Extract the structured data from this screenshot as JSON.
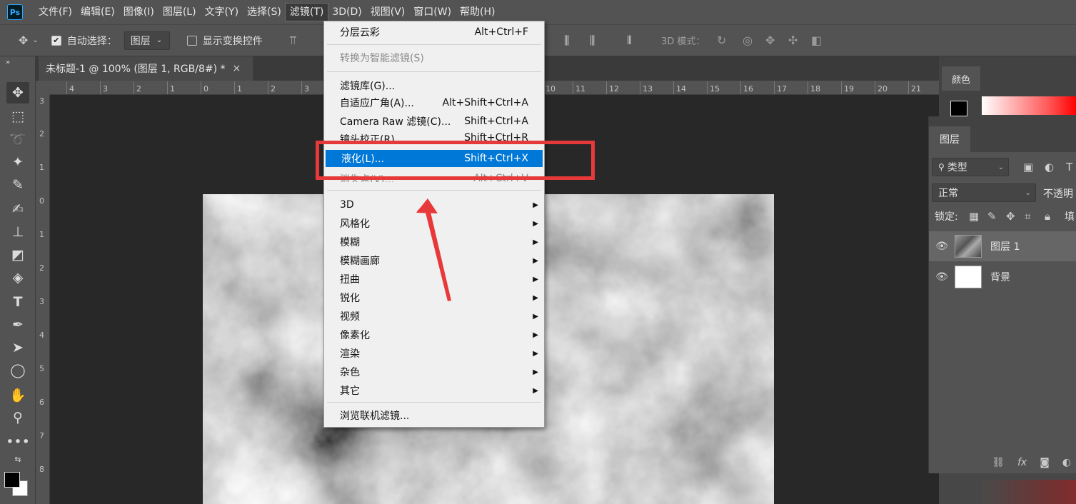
{
  "menubar": {
    "logo": "Ps",
    "items": [
      "文件(F)",
      "编辑(E)",
      "图像(I)",
      "图层(L)",
      "文字(Y)",
      "选择(S)",
      "滤镜(T)",
      "3D(D)",
      "视图(V)",
      "窗口(W)",
      "帮助(H)"
    ],
    "active_index": 6
  },
  "options": {
    "auto_select_label": "自动选择：",
    "auto_select_checked": true,
    "auto_select_target": "图层",
    "show_transform_label": "显示变换控件",
    "show_transform_checked": false,
    "mode_3d_label": "3D 模式："
  },
  "document": {
    "tab_title": "未标题-1 @ 100% (图层 1, RGB/8#) *",
    "close": "×"
  },
  "ruler": {
    "h_labels": [
      "4",
      "3",
      "2",
      "1",
      "0",
      "1",
      "2",
      "3",
      "10",
      "11",
      "12",
      "13",
      "14",
      "15",
      "16",
      "17",
      "18",
      "19",
      "20",
      "21"
    ],
    "v_labels": [
      "3",
      "2",
      "1",
      "0",
      "1",
      "2",
      "3",
      "4",
      "5",
      "6",
      "7",
      "8"
    ]
  },
  "filter_menu": {
    "items": [
      {
        "label": "分层云彩",
        "shortcut": "Alt+Ctrl+F",
        "state": "normal"
      },
      {
        "label": "转换为智能滤镜(S)",
        "shortcut": "",
        "state": "disabled"
      },
      {
        "label": "滤镜库(G)...",
        "shortcut": "",
        "state": "normal"
      },
      {
        "label": "自适应广角(A)...",
        "shortcut": "Alt+Shift+Ctrl+A",
        "state": "normal"
      },
      {
        "label": "Camera Raw 滤镜(C)...",
        "shortcut": "Shift+Ctrl+A",
        "state": "normal"
      },
      {
        "label": "镜头校正(R)...",
        "shortcut": "Shift+Ctrl+R",
        "state": "obscured"
      },
      {
        "label": "液化(L)...",
        "shortcut": "Shift+Ctrl+X",
        "state": "highlighted"
      },
      {
        "label": "消失点(V)...",
        "shortcut": "Alt+Ctrl+V",
        "state": "obscured-disabled"
      },
      {
        "label": "3D",
        "submenu": true
      },
      {
        "label": "风格化",
        "submenu": true
      },
      {
        "label": "模糊",
        "submenu": true
      },
      {
        "label": "模糊画廊",
        "submenu": true
      },
      {
        "label": "扭曲",
        "submenu": true
      },
      {
        "label": "锐化",
        "submenu": true
      },
      {
        "label": "视频",
        "submenu": true
      },
      {
        "label": "像素化",
        "submenu": true
      },
      {
        "label": "渲染",
        "submenu": true
      },
      {
        "label": "杂色",
        "submenu": true
      },
      {
        "label": "其它",
        "submenu": true
      },
      {
        "label": "浏览联机滤镜...",
        "shortcut": "",
        "state": "normal"
      }
    ]
  },
  "color_panel": {
    "tab": "颜色",
    "foreground": "#000000"
  },
  "layers_panel": {
    "tab": "图层",
    "filter_label": "类型",
    "blend_mode": "正常",
    "opacity_label": "不透明",
    "lock_label": "锁定:",
    "fill_label": "填",
    "layers": [
      {
        "name": "图层 1",
        "selected": true
      },
      {
        "name": "背景",
        "selected": false
      }
    ],
    "bottom_fx": "fx"
  },
  "colors": {
    "highlight": "#0078d7",
    "annotation_red": "#e8393a"
  }
}
